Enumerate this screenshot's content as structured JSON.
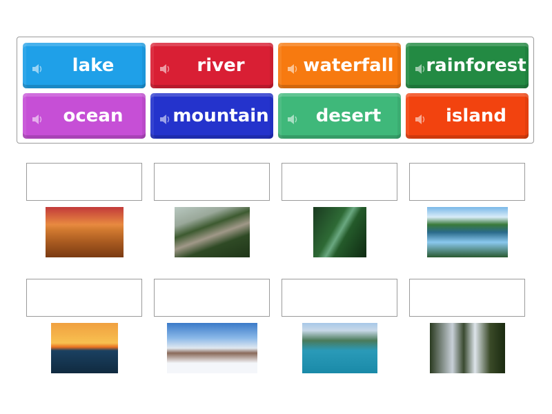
{
  "tiles": [
    {
      "label": "lake",
      "color": "#1fa0e8",
      "icon": "speaker-icon"
    },
    {
      "label": "river",
      "color": "#d91f34",
      "icon": "speaker-icon"
    },
    {
      "label": "waterfall",
      "color": "#f77a10",
      "icon": "speaker-icon"
    },
    {
      "label": "rainforest",
      "color": "#238a43",
      "icon": "speaker-icon"
    },
    {
      "label": "ocean",
      "color": "#c64fd6",
      "icon": "speaker-icon"
    },
    {
      "label": "mountain",
      "color": "#2433cc",
      "icon": "speaker-icon"
    },
    {
      "label": "desert",
      "color": "#3fb87a",
      "icon": "speaker-icon"
    },
    {
      "label": "island",
      "color": "#f2430f",
      "icon": "speaker-icon"
    }
  ],
  "images": [
    "desert",
    "river",
    "rainforest",
    "lake",
    "ocean-sunset",
    "mountain",
    "island",
    "waterfall"
  ]
}
